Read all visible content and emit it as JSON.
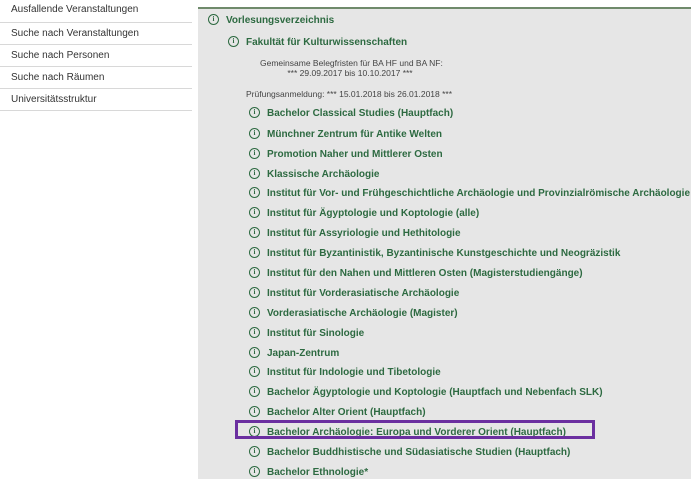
{
  "sidebar": {
    "items": [
      {
        "label": "Ausfallende Veranstaltungen"
      },
      {
        "label": "Suche nach Veranstaltungen"
      },
      {
        "label": "Suche nach Personen"
      },
      {
        "label": "Suche nach Räumen"
      },
      {
        "label": "Universitätsstruktur"
      }
    ]
  },
  "tree": {
    "root": "Vorlesungsverzeichnis",
    "faculty": "Fakultät für Kulturwissenschaften",
    "note1_line1": "Gemeinsame Belegfristen für BA HF und BA NF:",
    "note1_line2": "*** 29.09.2017 bis 10.10.2017 ***",
    "note2": "Prüfungsanmeldung: *** 15.01.2018 bis 26.01.2018 ***",
    "items": [
      "Bachelor Classical Studies (Hauptfach)",
      "Münchner Zentrum für Antike Welten",
      "Promotion Naher und Mittlerer Osten",
      "Klassische Archäologie",
      "Institut für Vor- und Frühgeschichtliche Archäologie und Provinzialrömische Archäologie",
      "Institut für Ägyptologie und Koptologie (alle)",
      "Institut für Assyriologie und Hethitologie",
      "Institut für Byzantinistik, Byzantinische Kunstgeschichte und Neogräzistik",
      "Institut für den Nahen und Mittleren Osten (Magisterstudiengänge)",
      "Institut für Vorderasiatische Archäologie",
      "Vorderasiatische Archäologie (Magister)",
      "Institut für Sinologie",
      "Japan-Zentrum",
      "Institut für Indologie und Tibetologie",
      "Bachelor Ägyptologie und Koptologie (Hauptfach und Nebenfach SLK)",
      "Bachelor Alter Orient (Hauptfach)",
      "Bachelor Archäologie: Europa und Vorderer Orient (Hauptfach)",
      "Bachelor Buddhistische und Südasiatische Studien (Hauptfach)",
      "Bachelor Ethnologie*"
    ]
  },
  "info_icon_glyph": "i",
  "colors": {
    "link_green": "#2d6a41",
    "panel_bg": "#e6e6e6",
    "highlight_purple": "#6b2fa0"
  }
}
